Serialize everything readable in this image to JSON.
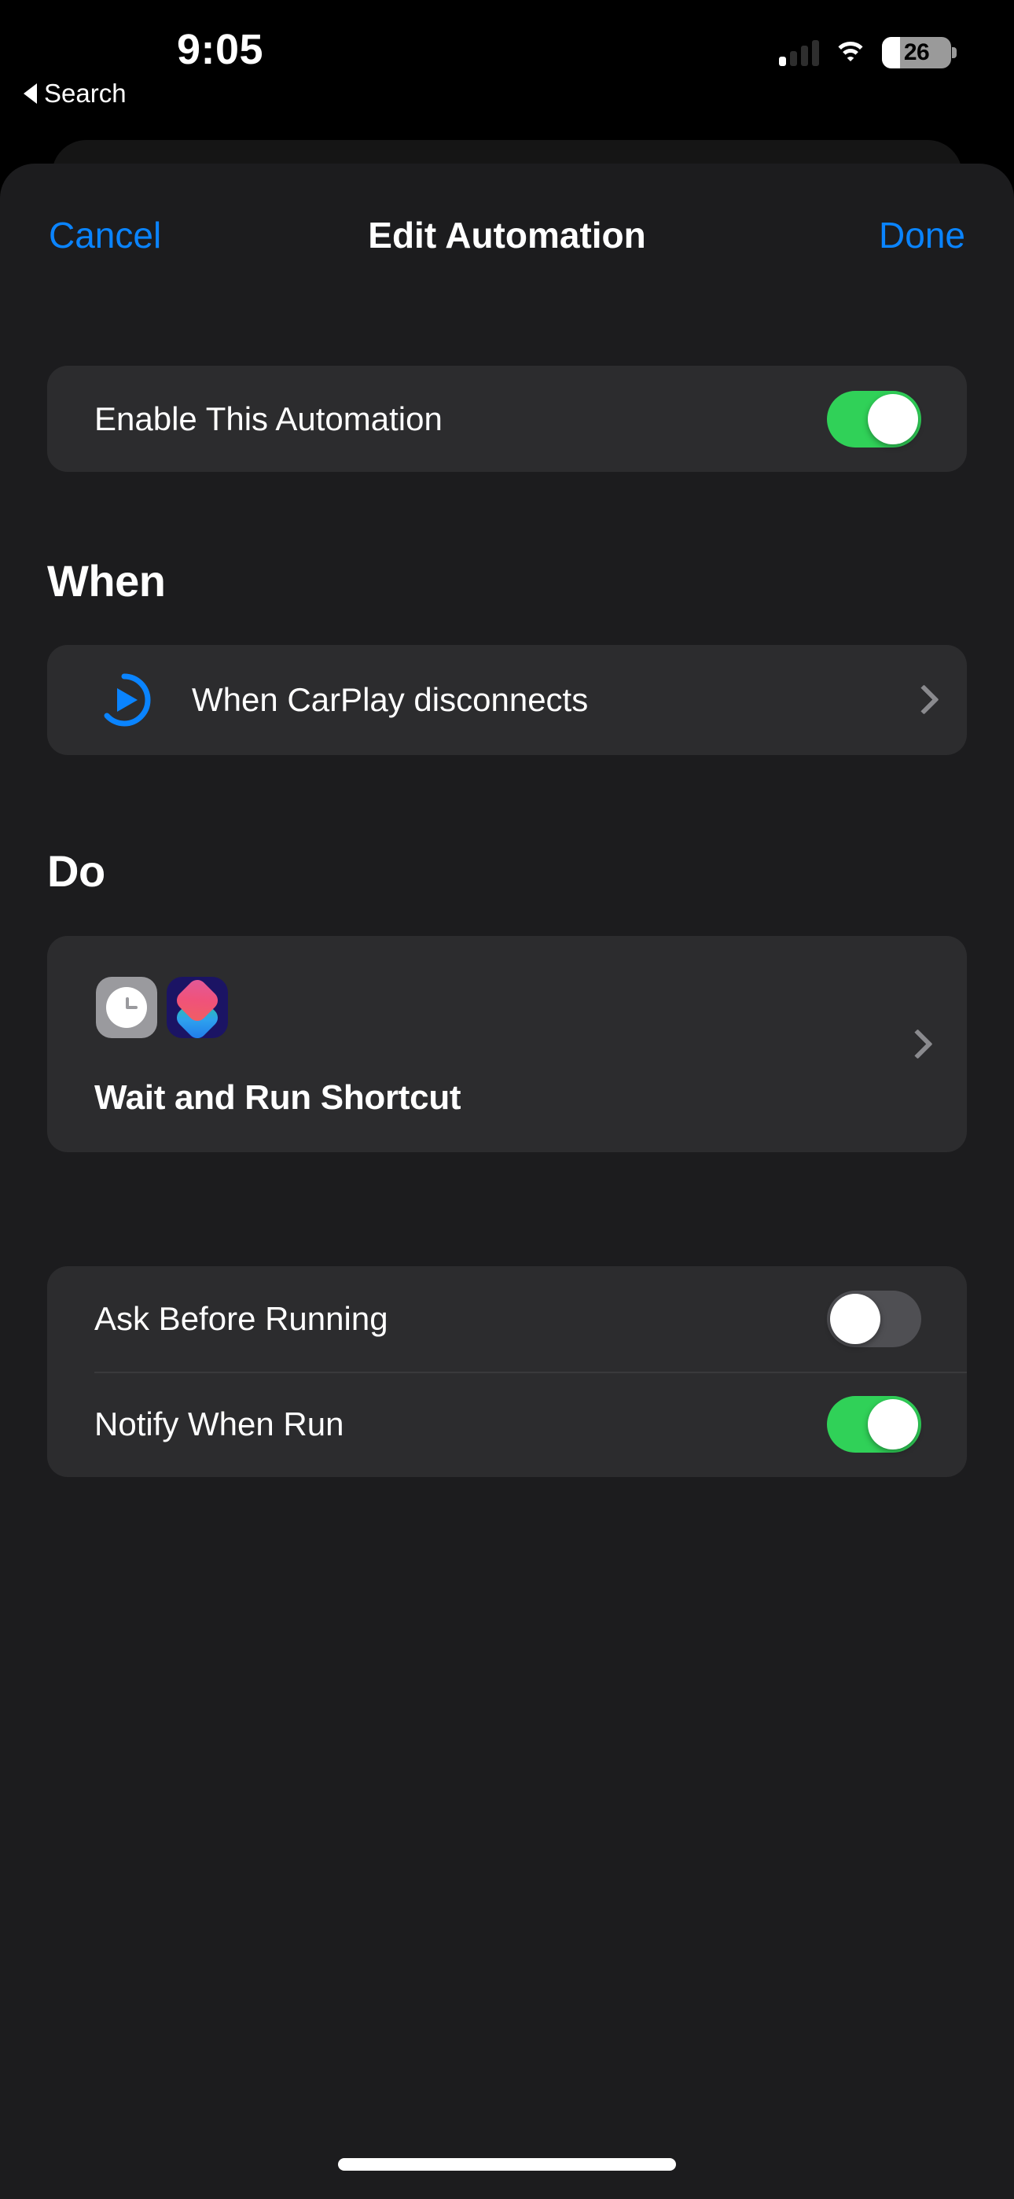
{
  "status_bar": {
    "time": "9:05",
    "battery_percent": "26",
    "battery_level": 26,
    "signal_icon": "cellular-signal-icon",
    "wifi_icon": "wifi-icon",
    "battery_icon": "battery-icon"
  },
  "back_link": {
    "label": "Search",
    "icon": "back-triangle-icon"
  },
  "navbar": {
    "cancel_label": "Cancel",
    "title": "Edit Automation",
    "done_label": "Done"
  },
  "enable_section": {
    "label": "Enable This Automation",
    "toggle_state": "on"
  },
  "when_section": {
    "heading": "When",
    "trigger": {
      "label": "When CarPlay disconnects",
      "icon": "carplay-trigger-icon",
      "chevron": "chevron-right-icon"
    }
  },
  "do_section": {
    "heading": "Do",
    "action": {
      "title": "Wait and Run Shortcut",
      "icons": [
        "clock-icon",
        "shortcuts-app-icon"
      ],
      "chevron": "chevron-right-icon"
    }
  },
  "options_section": {
    "rows": [
      {
        "label": "Ask Before Running",
        "toggle_state": "off"
      },
      {
        "label": "Notify When Run",
        "toggle_state": "on"
      }
    ]
  },
  "colors": {
    "accent_blue": "#0a84ff",
    "toggle_on_green": "#30d158",
    "toggle_off_gray": "#4f4f53",
    "card_background": "#2c2c2e",
    "sheet_background": "#1c1c1e",
    "shortcuts_icon_navy": "#1b1464"
  },
  "home_indicator": "home-indicator"
}
